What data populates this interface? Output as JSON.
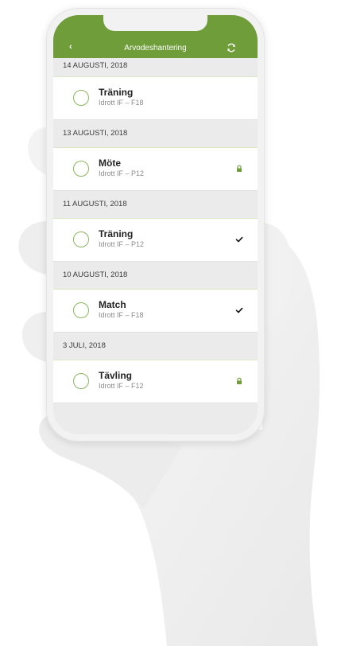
{
  "header": {
    "back_label": "‹",
    "title": "Arvodeshantering",
    "refresh_icon": "refresh-icon",
    "background": "#6f9d3a"
  },
  "sections": [
    {
      "date": "14 AUGUSTI, 2018",
      "items": [
        {
          "name": "Träning",
          "sub": "Idrott IF – F18",
          "status": "none"
        }
      ]
    },
    {
      "date": "13 AUGUSTI, 2018",
      "items": [
        {
          "name": "Möte",
          "sub": "Idrott IF – P12",
          "status": "lock"
        }
      ]
    },
    {
      "date": "11 AUGUSTI, 2018",
      "items": [
        {
          "name": "Träning",
          "sub": "Idrott IF – P12",
          "status": "check"
        }
      ]
    },
    {
      "date": "10 AUGUSTI, 2018",
      "items": [
        {
          "name": "Match",
          "sub": "Idrott IF – F18",
          "status": "check"
        }
      ]
    },
    {
      "date": "3 JULI, 2018",
      "items": [
        {
          "name": "Tävling",
          "sub": "Idrott IF – F12",
          "status": "lock"
        }
      ]
    }
  ],
  "colors": {
    "accent": "#6f9d3a",
    "lock": "#6f9d3a",
    "check": "#111111",
    "circle": "#8bb561"
  }
}
